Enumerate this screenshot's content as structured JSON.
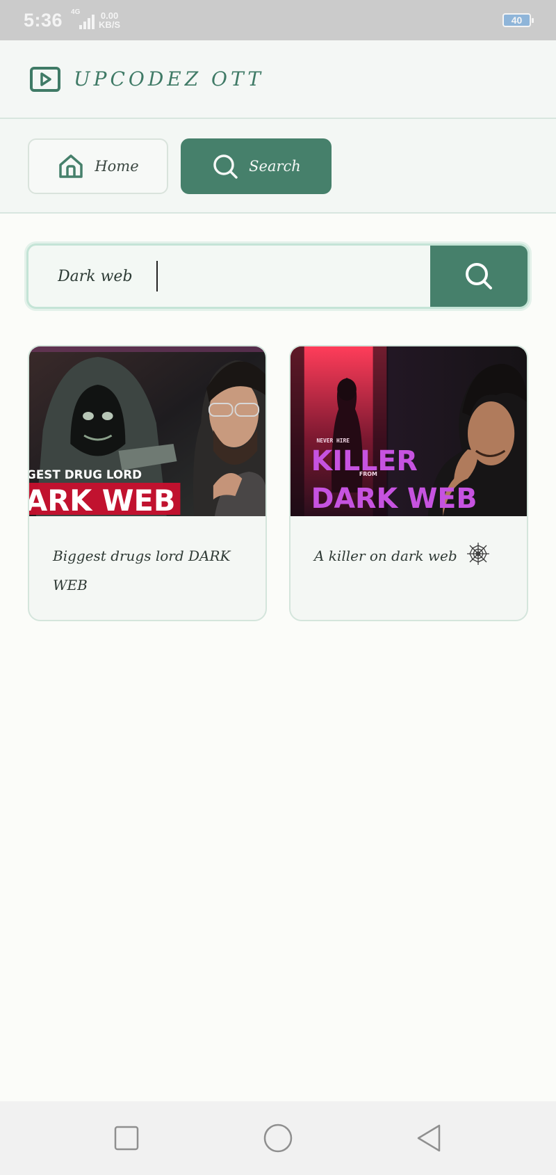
{
  "status_bar": {
    "time": "5:36",
    "network_type": "4G",
    "speed_value": "0.00",
    "speed_unit": "KB/S",
    "battery_level": "40"
  },
  "header": {
    "app_title": "UPCODEZ OTT",
    "logo_icon": "play-screen-icon"
  },
  "nav": {
    "home_label": "Home",
    "search_label": "Search",
    "active": "search"
  },
  "search": {
    "query": "Dark web",
    "button_icon": "search-icon"
  },
  "results": [
    {
      "title": "Biggest drugs lord DARK WEB",
      "thumbnail_text": [
        "GEST DRUG LORD",
        "ARK WEB"
      ]
    },
    {
      "title": "A killer on dark web",
      "title_icon": "spider-web-icon",
      "thumbnail_text": [
        "NEVER HIRE",
        "KILLER",
        "FROM",
        "DARK WEB"
      ]
    }
  ],
  "android_nav": {
    "keys": [
      "recent-apps",
      "home",
      "back"
    ]
  },
  "colors": {
    "accent": "#46806b",
    "title": "#3f7a66",
    "background": "#fbfcf9"
  }
}
